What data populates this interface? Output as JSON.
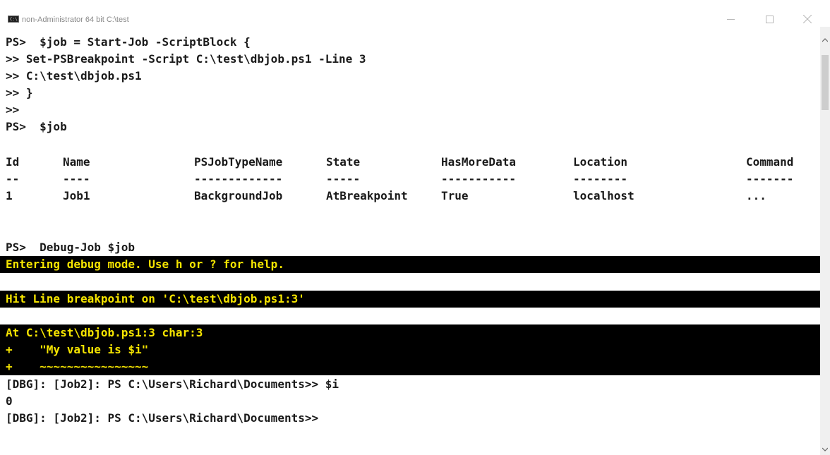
{
  "window": {
    "title": "non-Administrator 64 bit C:\\test",
    "app_icon_label": "C:\\",
    "controls": [
      "minimize",
      "maximize",
      "close"
    ]
  },
  "console": {
    "commands": [
      "PS>  $job = Start-Job -ScriptBlock {",
      ">> Set-PSBreakpoint -Script C:\\test\\dbjob.ps1 -Line 3",
      ">> C:\\test\\dbjob.ps1",
      ">> }",
      ">>",
      "PS>  $job"
    ],
    "job_table": {
      "headers": [
        "Id",
        "Name",
        "PSJobTypeName",
        "State",
        "HasMoreData",
        "Location",
        "Command"
      ],
      "underlines": [
        "--",
        "----",
        "-------------",
        "-----",
        "-----------",
        "--------",
        "-------"
      ],
      "rows": [
        [
          "1",
          "Job1",
          "BackgroundJob",
          "AtBreakpoint",
          "True",
          "localhost",
          "..."
        ]
      ]
    },
    "debug_command": "PS>  Debug-Job $job",
    "debug_enter": "Entering debug mode. Use h or ? for help.",
    "breakpoint_hit": "Hit Line breakpoint on 'C:\\test\\dbjob.ps1:3'",
    "position_block": [
      "At C:\\test\\dbjob.ps1:3 char:3",
      "+    \"My value is $i\"",
      "+    ~~~~~~~~~~~~~~~~"
    ],
    "debug_session": [
      "[DBG]: [Job2]: PS C:\\Users\\Richard\\Documents>> $i",
      "0",
      "[DBG]: [Job2]: PS C:\\Users\\Richard\\Documents>>"
    ]
  },
  "colors": {
    "console_bg": "#ffffff",
    "console_text": "#1a1a1a",
    "highlight_bg": "#000000",
    "highlight_text": "#f5e400"
  }
}
